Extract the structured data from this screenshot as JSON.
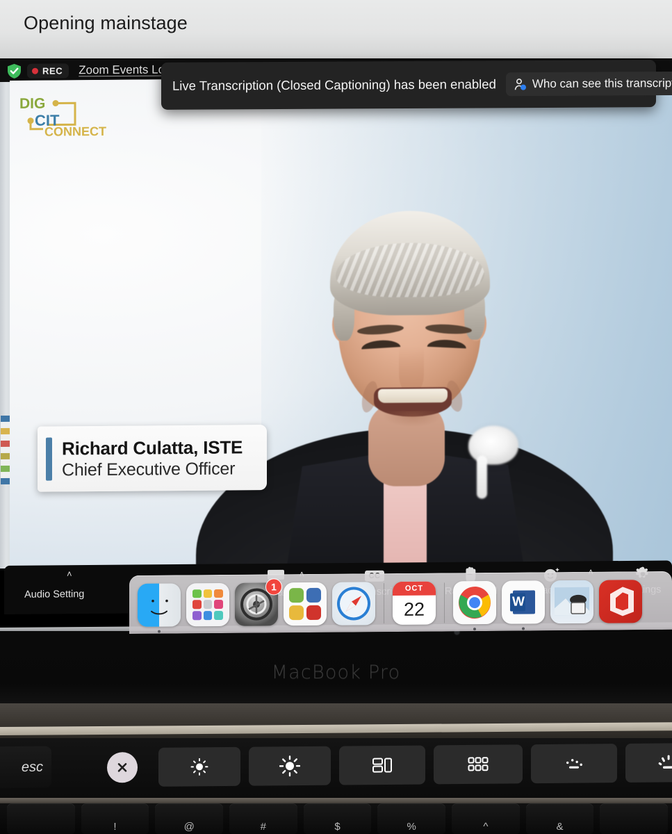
{
  "scene": {
    "wall_title": "Opening mainstage",
    "laptop_model": "MacBook Pro"
  },
  "zoom_window": {
    "security_icon": "shield-check-icon",
    "recording_label": "REC",
    "window_title": "Zoom Events Lob",
    "accent_blue": "#4b7fa8",
    "rec_red": "#d8313a",
    "shield_green": "#3ebb5c"
  },
  "toast": {
    "message": "Live Transcription (Closed Captioning) has been enabled",
    "link_label": "Who can see this transcript?",
    "link_icon": "person-icon",
    "close_label": "✕",
    "bg": "#232323"
  },
  "branding": {
    "logo_line1": "DIG",
    "logo_line2": "CIT",
    "logo_line3": "CONNECT",
    "green": "#8aa83c",
    "blue": "#3d7fa8",
    "gold": "#d5b44a"
  },
  "nameplate": {
    "name": "Richard Culatta, ISTE",
    "role": "Chief Executive Officer"
  },
  "toolbar": {
    "items": [
      {
        "label": "Audio Setting",
        "icon": "audio-settings-icon",
        "caret": "˄"
      },
      {
        "label": "Chat",
        "icon": "chat-bubble-icon",
        "caret": "˄"
      },
      {
        "label": "Live Transcription",
        "icon": "cc-icon",
        "caret": ""
      },
      {
        "label": "Raise Hand",
        "icon": "raised-hand-icon",
        "caret": ""
      },
      {
        "label": "Reactions",
        "icon": "reactions-smiley-icon",
        "caret": "˄"
      },
      {
        "label": "Settings",
        "icon": "gear-icon",
        "caret": ""
      }
    ],
    "cc_text": "CC"
  },
  "dock": {
    "items": [
      {
        "name": "Finder",
        "icon": "finder-icon",
        "badge": "",
        "running": true
      },
      {
        "name": "Launchpad",
        "icon": "launchpad-icon",
        "badge": "",
        "running": false
      },
      {
        "name": "System Preferences",
        "icon": "system-preferences-icon",
        "badge": "1",
        "running": false
      },
      {
        "name": "Color App",
        "icon": "color-squares-icon",
        "badge": "",
        "running": false
      },
      {
        "name": "Safari",
        "icon": "safari-compass-icon",
        "badge": "",
        "running": false
      },
      {
        "name": "Calendar",
        "icon": "calendar-icon",
        "badge": "",
        "running": true
      },
      {
        "name": "Google Chrome",
        "icon": "chrome-icon",
        "badge": "",
        "running": true
      },
      {
        "name": "Microsoft Word",
        "icon": "word-icon",
        "badge": "",
        "running": true
      },
      {
        "name": "Preview",
        "icon": "preview-icon",
        "badge": "",
        "running": true
      },
      {
        "name": "Microsoft Office",
        "icon": "office-icon",
        "badge": "",
        "running": false
      }
    ],
    "calendar_month": "OCT",
    "calendar_day": "22",
    "word_letter": "W"
  },
  "touchbar": {
    "esc_label": "esc",
    "keys": [
      {
        "icon": "close-x-icon",
        "name": "close-button"
      },
      {
        "icon": "brightness-down-icon",
        "name": "brightness-down-key"
      },
      {
        "icon": "brightness-up-icon",
        "name": "brightness-up-key"
      },
      {
        "icon": "mission-control-icon",
        "name": "mission-control-key"
      },
      {
        "icon": "launchpad-grid-icon",
        "name": "launchpad-key"
      },
      {
        "icon": "keyboard-brightness-down-icon",
        "name": "keyboard-brightness-down-key"
      },
      {
        "icon": "keyboard-brightness-up-icon",
        "name": "keyboard-brightness-up-key"
      },
      {
        "icon": "rewind-icon",
        "name": "rewind-key"
      }
    ]
  },
  "keyboard": {
    "keys": [
      "",
      "!",
      "@",
      "#",
      "$",
      "%",
      "^",
      "&",
      ""
    ]
  }
}
